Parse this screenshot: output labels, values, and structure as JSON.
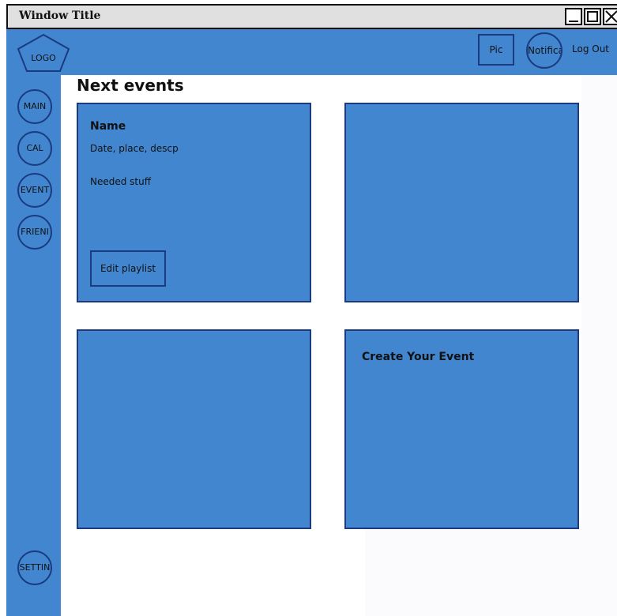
{
  "window": {
    "title": "Window Title"
  },
  "header": {
    "logo_label": "LOGO",
    "pic_label": "Pic",
    "notifications_label": "Notifica",
    "logout_label": "Log Out"
  },
  "sidebar": {
    "items": [
      {
        "label": "MAIN"
      },
      {
        "label": "CAL"
      },
      {
        "label": "EVENT"
      },
      {
        "label": "FRIENI"
      }
    ],
    "settings_label": "SETTIN"
  },
  "main": {
    "heading": "Next events",
    "event_card": {
      "name": "Name",
      "details": "Date, place, descp",
      "needed": "Needed stuff",
      "edit_button": "Edit playlist"
    },
    "create_card": {
      "title": "Create Your Event"
    }
  },
  "colors": {
    "panel_blue": "#4186cf",
    "border_navy": "#1b3a80",
    "titlebar_gray": "#e0e0e0"
  }
}
